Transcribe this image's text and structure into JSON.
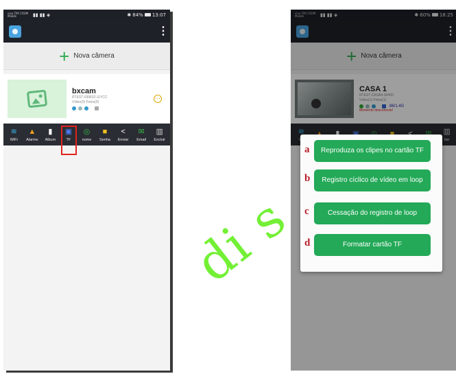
{
  "left_screen": {
    "status_carrier": "vivo\nTIM 15SIM Mobile",
    "status_right": "84%",
    "status_time": "13:07",
    "new_camera_label": "Nova câmera",
    "device": {
      "name": "bxcam",
      "id": "RTEST-039632-JLYCC",
      "media": "Vídeo(0) Fotos(0)"
    },
    "toolbar": [
      {
        "label": "WiFi",
        "icon": "wifi-icon",
        "color": "#3ab7f0"
      },
      {
        "label": "Alarme",
        "icon": "bell-icon",
        "color": "#f0a020"
      },
      {
        "label": "Album",
        "icon": "album-icon",
        "color": "#ffffff"
      },
      {
        "label": "TF",
        "icon": "sd-card-icon",
        "color": "#4d7cf0"
      },
      {
        "label": "nome",
        "icon": "edit-icon",
        "color": "#3bb54a"
      },
      {
        "label": "Senha",
        "icon": "lock-icon",
        "color": "#f0c020"
      },
      {
        "label": "Enviar",
        "icon": "share-icon",
        "color": "#ffffff"
      },
      {
        "label": "Email",
        "icon": "email-icon",
        "color": "#3bb54a"
      },
      {
        "label": "Excluir",
        "icon": "trash-icon",
        "color": "#cccccc"
      }
    ]
  },
  "right_screen": {
    "status_carrier": "vivo\nTIM 15SIM Mobile",
    "status_right": "60%",
    "status_time": "18:25",
    "new_camera_label": "Nova câmera",
    "device": {
      "name": "CASA 1",
      "id": "RTEST-CASA4-30460",
      "media": "Vídeo(1) Fotos(1)",
      "sd": "86/1.4G",
      "status": "Momento desconecte!"
    },
    "toolbar_first_label": "Wi",
    "toolbar_last_label": "luir",
    "dialog_options": [
      {
        "letter": "a",
        "label": "Reproduza os clipes no cartão TF"
      },
      {
        "letter": "b",
        "label": "Registro cíclico de vídeo em loop"
      },
      {
        "letter": "c",
        "label": "Cessação do registro de loop"
      },
      {
        "letter": "d",
        "label": "Formatar cartão TF"
      }
    ]
  },
  "watermark": "di s"
}
